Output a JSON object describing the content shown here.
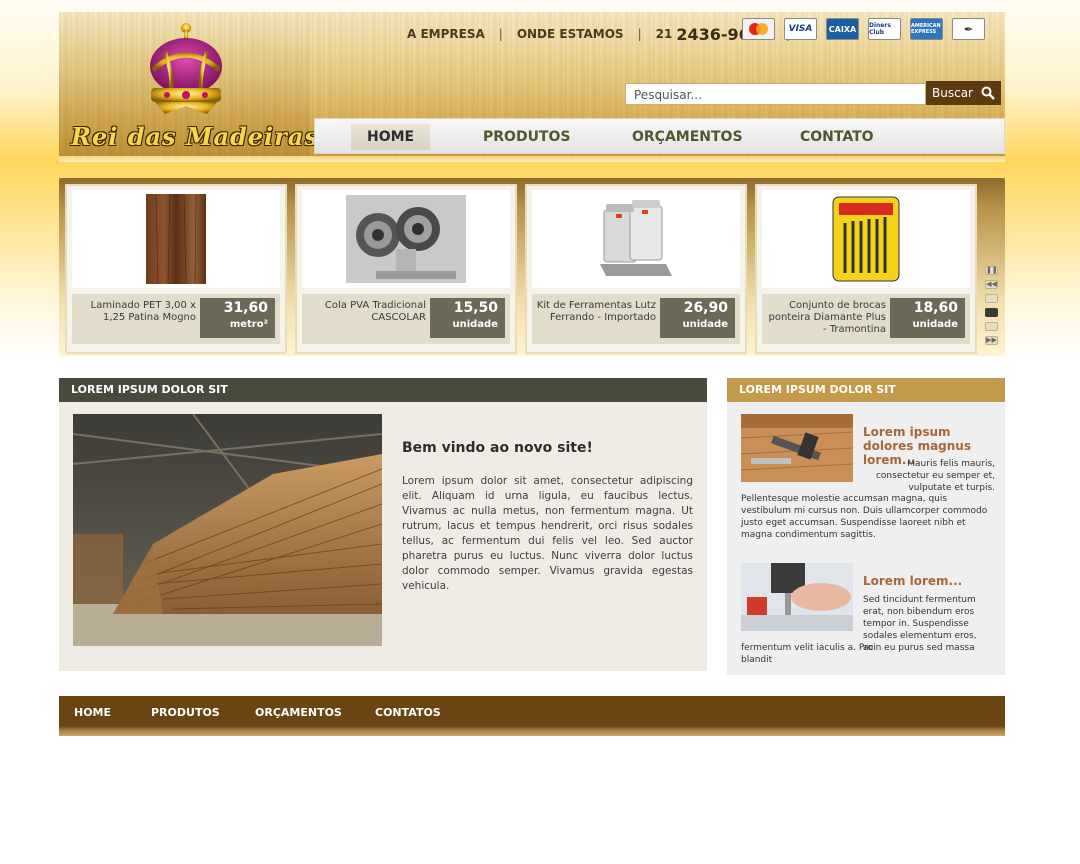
{
  "brand": {
    "logo_text": "Rei das Madeiras"
  },
  "toplinks": {
    "empresa": "A EMPRESA",
    "onde": "ONDE ESTAMOS",
    "phone_prefix": "21",
    "phone": "2436-9611"
  },
  "payment_cards": [
    "MasterCard",
    "VISA",
    "CAIXA",
    "Diners Club",
    "AMERICAN EXPRESS",
    "cheque"
  ],
  "search": {
    "placeholder": "Pesquisar...",
    "button": "Buscar"
  },
  "nav": {
    "home": "HOME",
    "produtos": "PRODUTOS",
    "orcamentos": "ORÇAMENTOS",
    "contato": "CONTATO"
  },
  "products": [
    {
      "name": "Laminado PET 3,00 x 1,25 Patina Mogno",
      "price": "31,60",
      "unit": "metro²"
    },
    {
      "name": "Cola PVA Tradicional CASCOLAR",
      "price": "15,50",
      "unit": "unidade"
    },
    {
      "name": "Kit de Ferramentas Lutz Ferrando - Importado",
      "price": "26,90",
      "unit": "unidade"
    },
    {
      "name": "Conjunto de brocas ponteira Diamante Plus - Tramontina",
      "price": "18,60",
      "unit": "unidade"
    }
  ],
  "left_panel": {
    "heading": "LOREM IPSUM DOLOR SIT",
    "welcome_title": "Bem vindo ao novo site!",
    "welcome_text": "Lorem ipsum dolor sit amet, consectetur adipiscing elit. Aliquam id urna ligula, eu faucibus lectus. Vivamus ac nulla metus, non fermentum magna. Ut rutrum, lacus et tempus hendrerit, orci risus sodales tellus, ac fermentum dui felis vel leo. Sed auctor pharetra purus eu luctus. Nunc viverra dolor luctus dolor commodo semper. Vivamus gravida egestas vehicula."
  },
  "right_panel": {
    "heading": "LOREM IPSUM DOLOR SIT",
    "news": [
      {
        "title": "Lorem ipsum dolores magnus lorem...",
        "body_short": "Mauris felis mauris, consectetur eu semper et, vulputate et turpis.",
        "body_long": "Pellentesque molestie accumsan magna, quis vestibulum mi cursus non. Duis ullamcorper commodo justo eget accumsan. Suspendisse laoreet nibh et magna condimentum sagittis."
      },
      {
        "title": "Lorem lorem...",
        "body_short": "Sed tincidunt fermentum erat, non bibendum eros tempor in. Suspendisse sodales elementum eros, ac",
        "body_long": "fermentum velit iaculis a. Proin eu purus sed massa blandit"
      }
    ]
  },
  "footer_nav": {
    "home": "HOME",
    "produtos": "PRODUTOS",
    "orcamentos": "ORÇAMENTOS",
    "contatos": "CONTATOS"
  },
  "colors": {
    "brown": "#6b4413",
    "gold": "#c39a4a",
    "dark_olive": "#4a4a3c",
    "nav_text": "#4c5a2a",
    "news_title": "#a8663a"
  }
}
